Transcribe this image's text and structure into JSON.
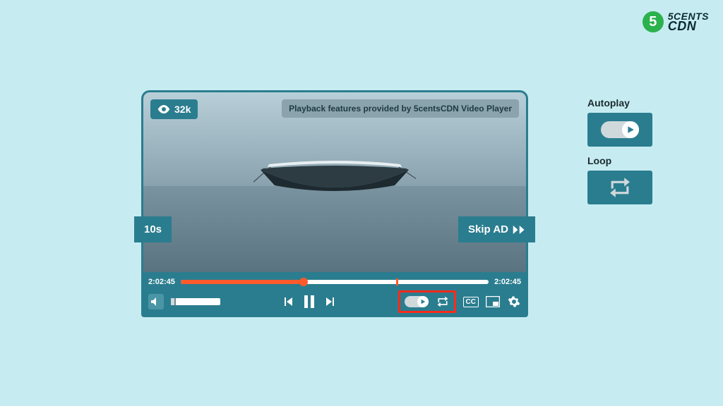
{
  "brand": {
    "digit": "5",
    "line1": "5CENTS",
    "line2": "CDN"
  },
  "player": {
    "views": "32k",
    "banner": "Playback features provided by 5centsCDN Video Player",
    "rewind_label": "10s",
    "skip_label": "Skip AD",
    "time_elapsed": "2:02:45",
    "time_total": "2:02:45",
    "progress_percent": 40,
    "marker_percent": 70,
    "cc_label": "CC"
  },
  "callouts": {
    "autoplay_label": "Autoplay",
    "loop_label": "Loop"
  },
  "colors": {
    "bg": "#c6ecf1",
    "teal": "#2a7d8f",
    "accent": "#ff5a2b",
    "highlight": "#ff2a1c",
    "brand_green": "#2bb24c"
  }
}
